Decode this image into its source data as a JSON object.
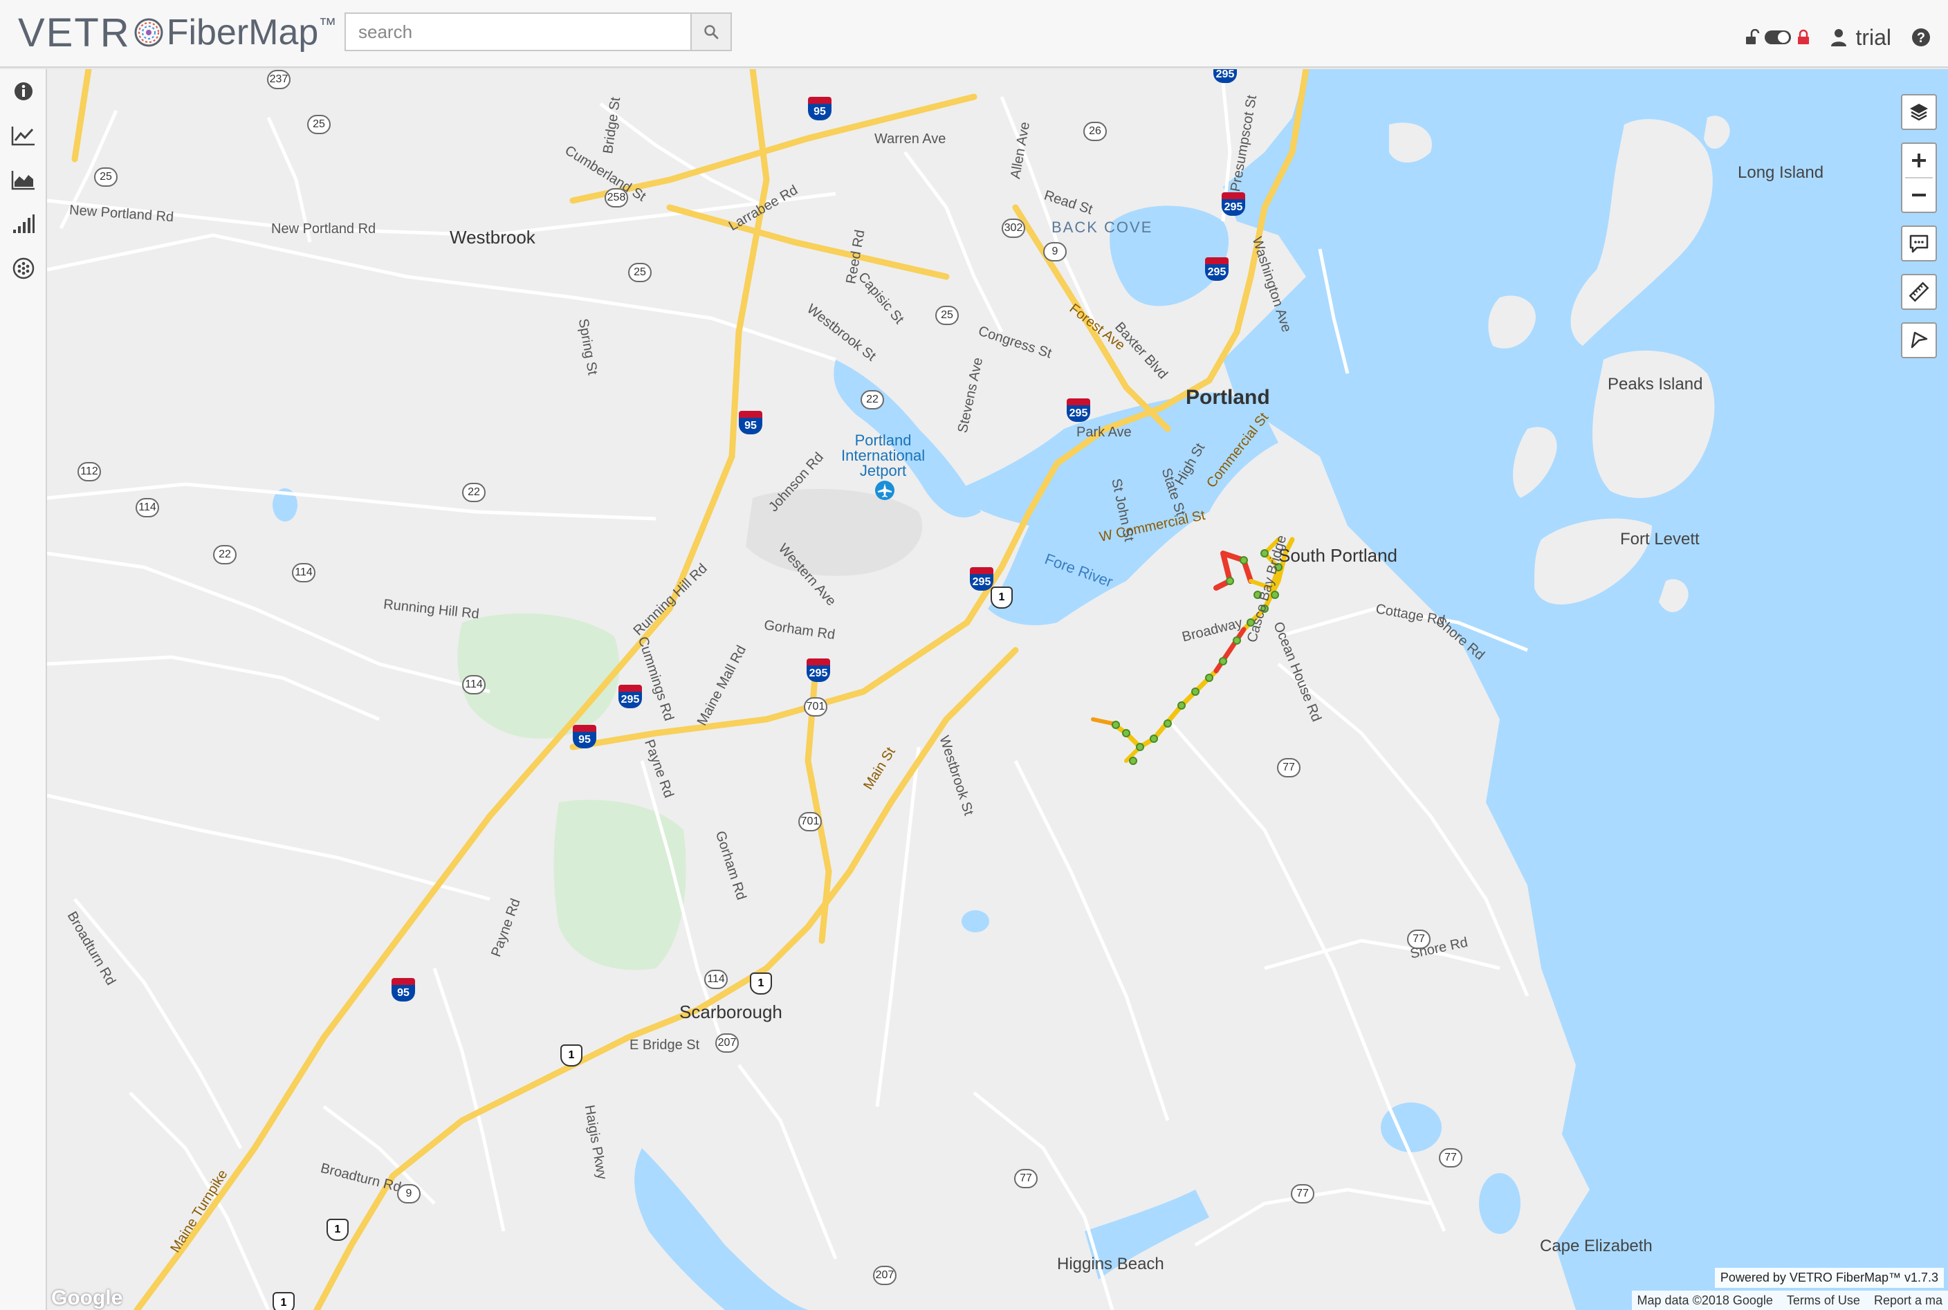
{
  "header": {
    "logo_brand_left": "VETR",
    "logo_brand_product": "FiberMap",
    "logo_tm": "™",
    "search_placeholder": "search",
    "user_name": "trial"
  },
  "sidebar": {
    "items": [
      {
        "icon": "info-icon"
      },
      {
        "icon": "line-chart-icon"
      },
      {
        "icon": "area-chart-icon"
      },
      {
        "icon": "bar-signal-icon"
      },
      {
        "icon": "fiber-bundle-icon"
      }
    ]
  },
  "map": {
    "places": {
      "westbrook": "Westbrook",
      "portland": "Portland",
      "back_cove": "BACK COVE",
      "south_portland": "South Portland",
      "long_island": "Long Island",
      "peaks_island": "Peaks Island",
      "fort_levett": "Fort Levett",
      "scarborough": "Scarborough",
      "cape_elizabeth": "Cape Elizabeth",
      "higgins_beach": "Higgins Beach",
      "jetport": "Portland\nInternational\nJetport",
      "fore_river": "Fore River"
    },
    "roads": {
      "new_portland_rd_1": "New Portland Rd",
      "new_portland_rd_2": "New Portland Rd",
      "warren_ave": "Warren Ave",
      "forest_ave": "Forest Ave",
      "w_commercial_st": "W Commercial St",
      "commercial_st": "Commercial St",
      "main_st": "Main St",
      "maine_turnpike": "Maine Turnpike",
      "broadway": "Broadway",
      "cottage_rd": "Cottage Rd",
      "shore_rd_1": "Shore Rd",
      "shore_rd_2": "Shore Rd",
      "ocean_house_rd": "Ocean House Rd",
      "running_hill_rd_1": "Running Hill Rd",
      "running_hill_rd_2": "Running Hill Rd",
      "gorham_rd": "Gorham Rd",
      "payne_rd_1": "Payne Rd",
      "payne_rd_2": "Payne Rd",
      "broadturn_rd_1": "Broadturn Rd",
      "broadturn_rd_2": "Broadturn Rd",
      "congress_st": "Congress St",
      "park_ave": "Park Ave",
      "westbrook_st": "Westbrook St",
      "johnson_rd": "Johnson Rd",
      "spring_st": "Spring St",
      "cummings_rd": "Cummings Rd",
      "maine_mall_rd": "Maine Mall Rd",
      "western_ave": "Western Ave",
      "brighton_ave": "Stevens Ave",
      "washington_ave": "Washington Ave",
      "high_st": "High St",
      "state_st": "State St",
      "st_john_st": "St John St",
      "allen_ave": "Allen Ave",
      "presumpscot_st": "Presumpscot St",
      "read_st": "Read St",
      "larrabee_rd": "Larrabee Rd",
      "capisic_st": "Capisic St",
      "baxter_blvd": "Baxter Blvd",
      "cumberland_st": "Cumberland St",
      "bridge_st": "Bridge St",
      "e_bridge_st": "E Bridge St",
      "casco_bay_bridge": "Casco Bay Bridge",
      "haigis_pkwy": "Haigis Pkwy",
      "reed_rd": "Reed Rd",
      "westbrook_st2": "Westbrook St",
      "gorham_rd2": "Gorham Rd"
    },
    "route_shields": {
      "i95_a": "95",
      "i95_b": "95",
      "i95_c": "95",
      "i95_d": "95",
      "i295_a": "295",
      "i295_b": "295",
      "i295_c": "295",
      "i295_d": "295",
      "i295_e": "295",
      "i295_f": "295",
      "i295_g": "295",
      "us1_a": "1",
      "us1_b": "1",
      "us1_c": "1",
      "us1_d": "1",
      "us1_e": "1",
      "s237": "237",
      "s25_a": "25",
      "s25_b": "25",
      "s25_c": "25",
      "s25_d": "25",
      "s258": "258",
      "s302": "302",
      "s26": "26",
      "s9_a": "9",
      "s9_b": "9",
      "s22_a": "22",
      "s22_b": "22",
      "s22_c": "22",
      "s112": "112",
      "s114_a": "114",
      "s114_b": "114",
      "s114_c": "114",
      "s114_d": "114",
      "s701_a": "701",
      "s701_b": "701",
      "s77_a": "77",
      "s77_b": "77",
      "s77_c": "77",
      "s77_d": "77",
      "s77_e": "77",
      "s207_a": "207",
      "s207_b": "207"
    }
  },
  "attribution": {
    "powered": "Powered by VETRO FiberMap™ v1.7.3",
    "map_data": "Map data ©2018 Google",
    "terms": "Terms of Use",
    "report": "Report a ma",
    "google": "Google"
  },
  "colors": {
    "water": "#aadaff",
    "land": "#eeeeee",
    "highway": "#f8d05a",
    "fiber_red": "#e8392b",
    "fiber_green": "#7ac143",
    "fiber_yellow": "#f1c40f",
    "park": "#d8edd5"
  }
}
